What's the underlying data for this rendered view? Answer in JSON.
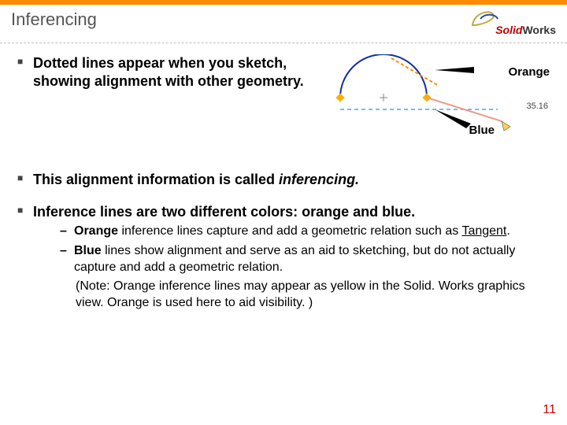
{
  "title": "Inferencing",
  "logo": {
    "brand_a": "Solid",
    "brand_b": "Works"
  },
  "bullets": {
    "b1": "Dotted lines appear when you sketch, showing alignment with other geometry.",
    "b2_a": "This alignment information is called ",
    "b2_b": "inferencing.",
    "b3": "Inference lines are two different colors: orange and blue."
  },
  "sub": {
    "s1_a": "Orange",
    "s1_b": " inference lines capture and add a geometric relation such as ",
    "s1_c": "Tangent",
    "s1_d": ".",
    "s2_a": "Blue",
    "s2_b": " lines show alignment and serve as an aid to sketching, but do not actually capture and add a geometric relation."
  },
  "note": " (Note: Orange inference lines may appear as yellow in the Solid. Works graphics view. Orange is used here to aid visibility. )",
  "diagram": {
    "label_orange": "Orange",
    "label_blue": "Blue",
    "dimension": "35.16"
  },
  "pagenum": "11"
}
